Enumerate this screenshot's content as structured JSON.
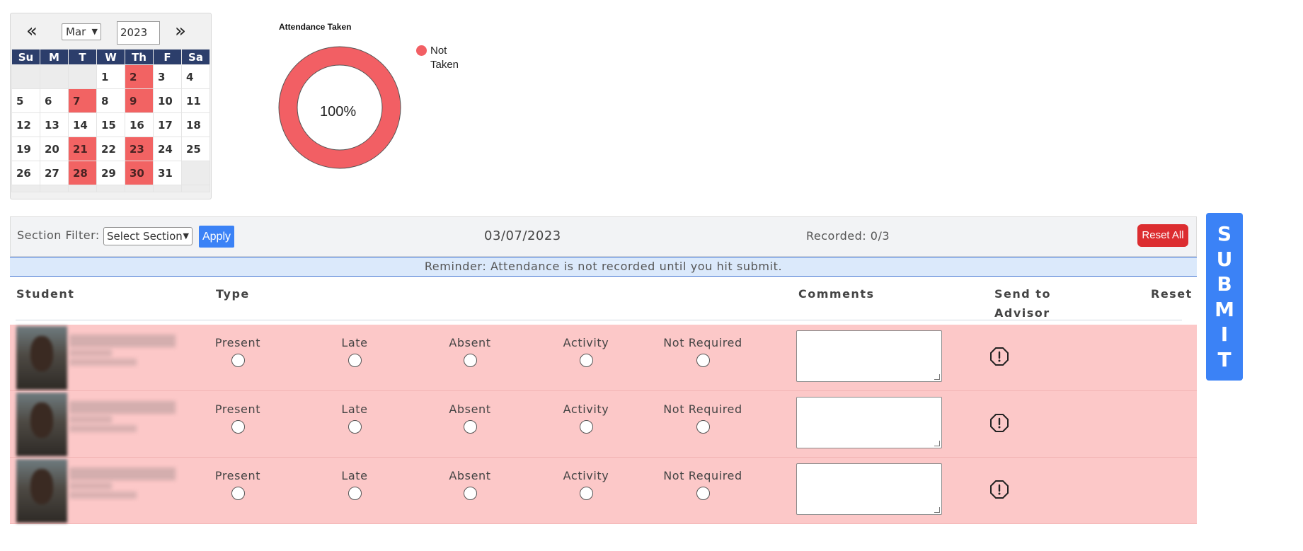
{
  "calendar": {
    "prev_label": "«",
    "next_label": "»",
    "month": "Mar",
    "year": "2023",
    "weekdays": [
      "Su",
      "M",
      "T",
      "W",
      "Th",
      "F",
      "Sa"
    ],
    "weeks": [
      [
        "",
        "",
        "",
        "1",
        "2",
        "3",
        "4"
      ],
      [
        "5",
        "6",
        "7",
        "8",
        "9",
        "10",
        "11"
      ],
      [
        "12",
        "13",
        "14",
        "15",
        "16",
        "17",
        "18"
      ],
      [
        "19",
        "20",
        "21",
        "22",
        "23",
        "24",
        "25"
      ],
      [
        "26",
        "27",
        "28",
        "29",
        "30",
        "31",
        ""
      ]
    ],
    "marked_days": [
      "2",
      "7",
      "9",
      "21",
      "23",
      "28",
      "30"
    ],
    "marked_color": "#f26363"
  },
  "chart": {
    "title": "Attendance Taken",
    "center_label": "100%",
    "legend_label": "Not Taken",
    "color": "#f25f64"
  },
  "chart_data": {
    "type": "pie",
    "title": "Attendance Taken",
    "categories": [
      "Not Taken"
    ],
    "values": [
      100
    ],
    "legend": "right"
  },
  "toolbar": {
    "filter_label": "Section Filter:",
    "section_select": "Select Section",
    "apply_label": "Apply",
    "date": "03/07/2023",
    "recorded": "Recorded: 0/3",
    "reset_all_label": "Reset All"
  },
  "reminder": "Reminder: Attendance is not recorded until you hit submit.",
  "columns": {
    "student": "Student",
    "type": "Type",
    "comments": "Comments",
    "advisor": "Send to Advisor",
    "reset": "Reset"
  },
  "attendance_options": [
    "Present",
    "Late",
    "Absent",
    "Activity",
    "Not Required"
  ],
  "students_count": 3,
  "submit_label": "SUBMIT",
  "colors": {
    "row_bg": "#fcc8c8",
    "primary": "#3b82f6",
    "danger": "#dc2d30",
    "header_navy": "#2c3e6b"
  }
}
